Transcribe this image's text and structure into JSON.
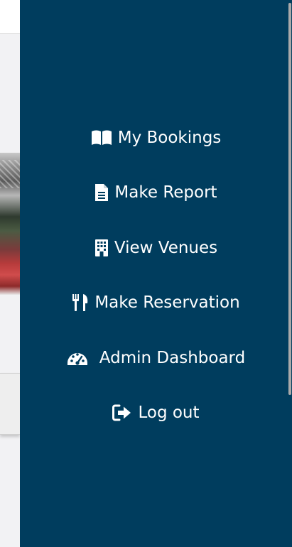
{
  "app": {
    "colors": {
      "drawer_bg": "#003d5e",
      "menu_text": "#ffffff"
    }
  },
  "nav_menu": {
    "items": [
      {
        "label": "My Bookings",
        "icon": "book-open-icon"
      },
      {
        "label": "Make Report",
        "icon": "file-text-icon"
      },
      {
        "label": "View Venues",
        "icon": "building-icon"
      },
      {
        "label": "Make Reservation",
        "icon": "utensils-icon"
      },
      {
        "label": "Admin Dashboard",
        "icon": "gauge-icon"
      },
      {
        "label": "Log out",
        "icon": "sign-out-icon"
      }
    ]
  }
}
